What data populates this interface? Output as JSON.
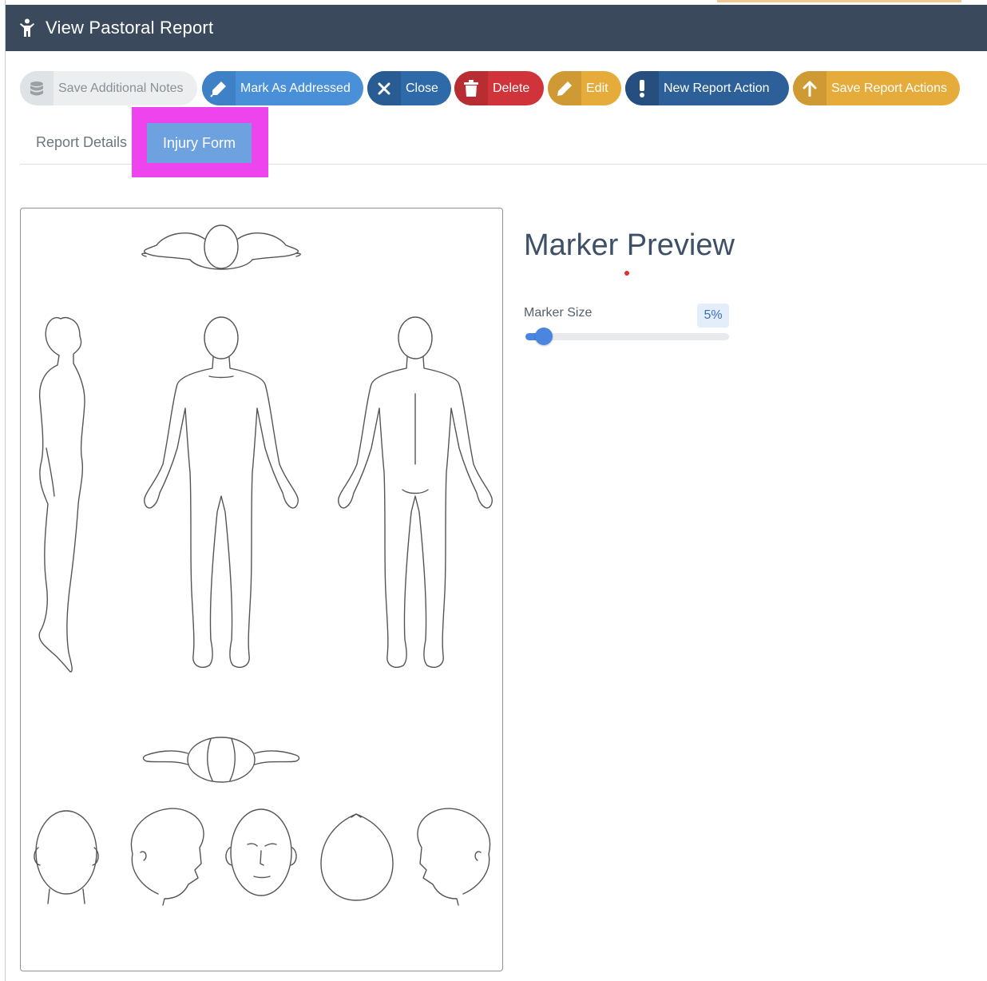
{
  "window": {
    "title": "View Pastoral Report",
    "app_icon": "person-icon"
  },
  "toolbar": {
    "save_notes": "Save Additional Notes",
    "mark_addressed": "Mark As Addressed",
    "close": "Close",
    "delete": "Delete",
    "edit": "Edit",
    "new_action": "New Report Action",
    "save_actions": "Save Report Actions"
  },
  "tabs": {
    "details": "Report Details",
    "injury": "Injury Form",
    "active": "injury"
  },
  "preview": {
    "title": "Marker Preview",
    "size_label": "Marker Size",
    "size_value": "5%",
    "size_fraction": 0.05,
    "marker_color": "#e03030"
  },
  "colors": {
    "header": "#3a4a5c",
    "blue": "#4a90d9",
    "dark_blue": "#2f6aa8",
    "red": "#d0343a",
    "yellow": "#e6ac3b",
    "navy": "#2d5f98",
    "highlight": "#ee44ee"
  }
}
